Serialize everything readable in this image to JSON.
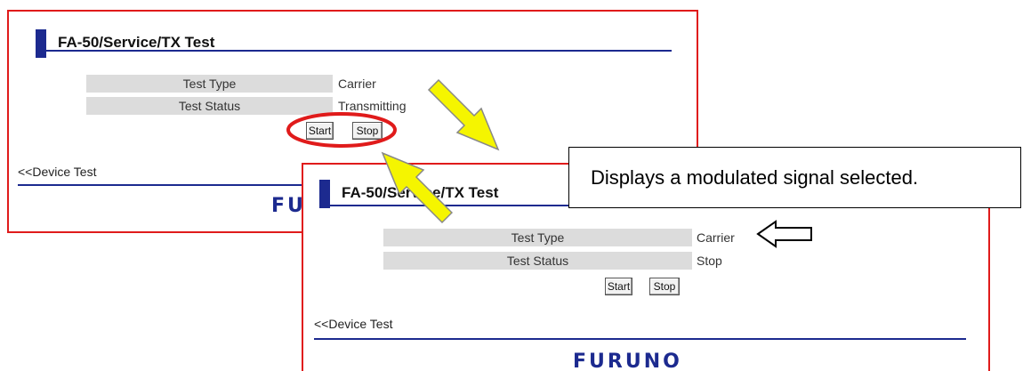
{
  "screen_before": {
    "title": "FA-50/Service/TX Test",
    "rows": [
      {
        "label": "Test Type",
        "value": "Carrier"
      },
      {
        "label": "Test Status",
        "value": "Transmitting"
      }
    ],
    "start_label": "Start",
    "stop_label": "Stop",
    "back_link": "<<Device Test",
    "logo": "FURUNO"
  },
  "screen_after": {
    "title": "FA-50/Service/TX Test",
    "rows": [
      {
        "label": "Test Type",
        "value": "Carrier"
      },
      {
        "label": "Test Status",
        "value": "Stop"
      }
    ],
    "start_label": "Start",
    "stop_label": "Stop",
    "back_link": "<<Device Test",
    "logo": "FURUNO"
  },
  "callout": {
    "text": "Displays a modulated signal selected."
  },
  "colors": {
    "brand_blue": "#1c2a8f",
    "frame_red": "#e01b1b",
    "arrow_yellow": "#f5f500",
    "label_gray": "#dcdcdc"
  },
  "icons": [
    "swap-arrows-icon",
    "pointer-arrow-icon",
    "highlight-circle"
  ]
}
